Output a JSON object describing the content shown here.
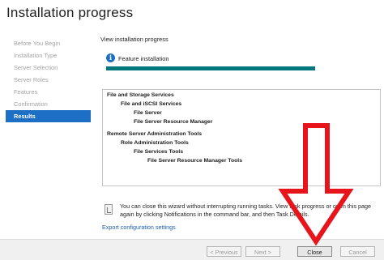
{
  "window": {
    "title": "Installation progress"
  },
  "nav": {
    "items": [
      {
        "label": "Before You Begin",
        "active": false
      },
      {
        "label": "Installation Type",
        "active": false
      },
      {
        "label": "Server Selection",
        "active": false
      },
      {
        "label": "Server Roles",
        "active": false
      },
      {
        "label": "Features",
        "active": false
      },
      {
        "label": "Confirmation",
        "active": false
      },
      {
        "label": "Results",
        "active": true
      }
    ]
  },
  "main": {
    "view_label": "View installation progress",
    "feature_label": "Feature installation",
    "progress_fraction": 1.0,
    "results": [
      "File and Storage Services",
      "File and iSCSI Services",
      "File Server",
      "File Server Resource Manager",
      "Remote Server Administration Tools",
      "Role Administration Tools",
      "File Services Tools",
      "File Server Resource Manager Tools"
    ],
    "notify_text": "You can close this wizard without interrupting running tasks. View task progress or open this page again by clicking Notifications in the command bar, and then Task Details.",
    "export_link": "Export configuration settings"
  },
  "footer": {
    "previous_label": "< Previous",
    "next_label": "Next >",
    "close_label": "Close",
    "cancel_label": "Cancel"
  },
  "annotation": {
    "arrow_color": "#e8141c"
  },
  "icons": {
    "info": "info-icon",
    "notification": "notification-flag-icon",
    "arrow": "red-down-arrow-icon"
  }
}
